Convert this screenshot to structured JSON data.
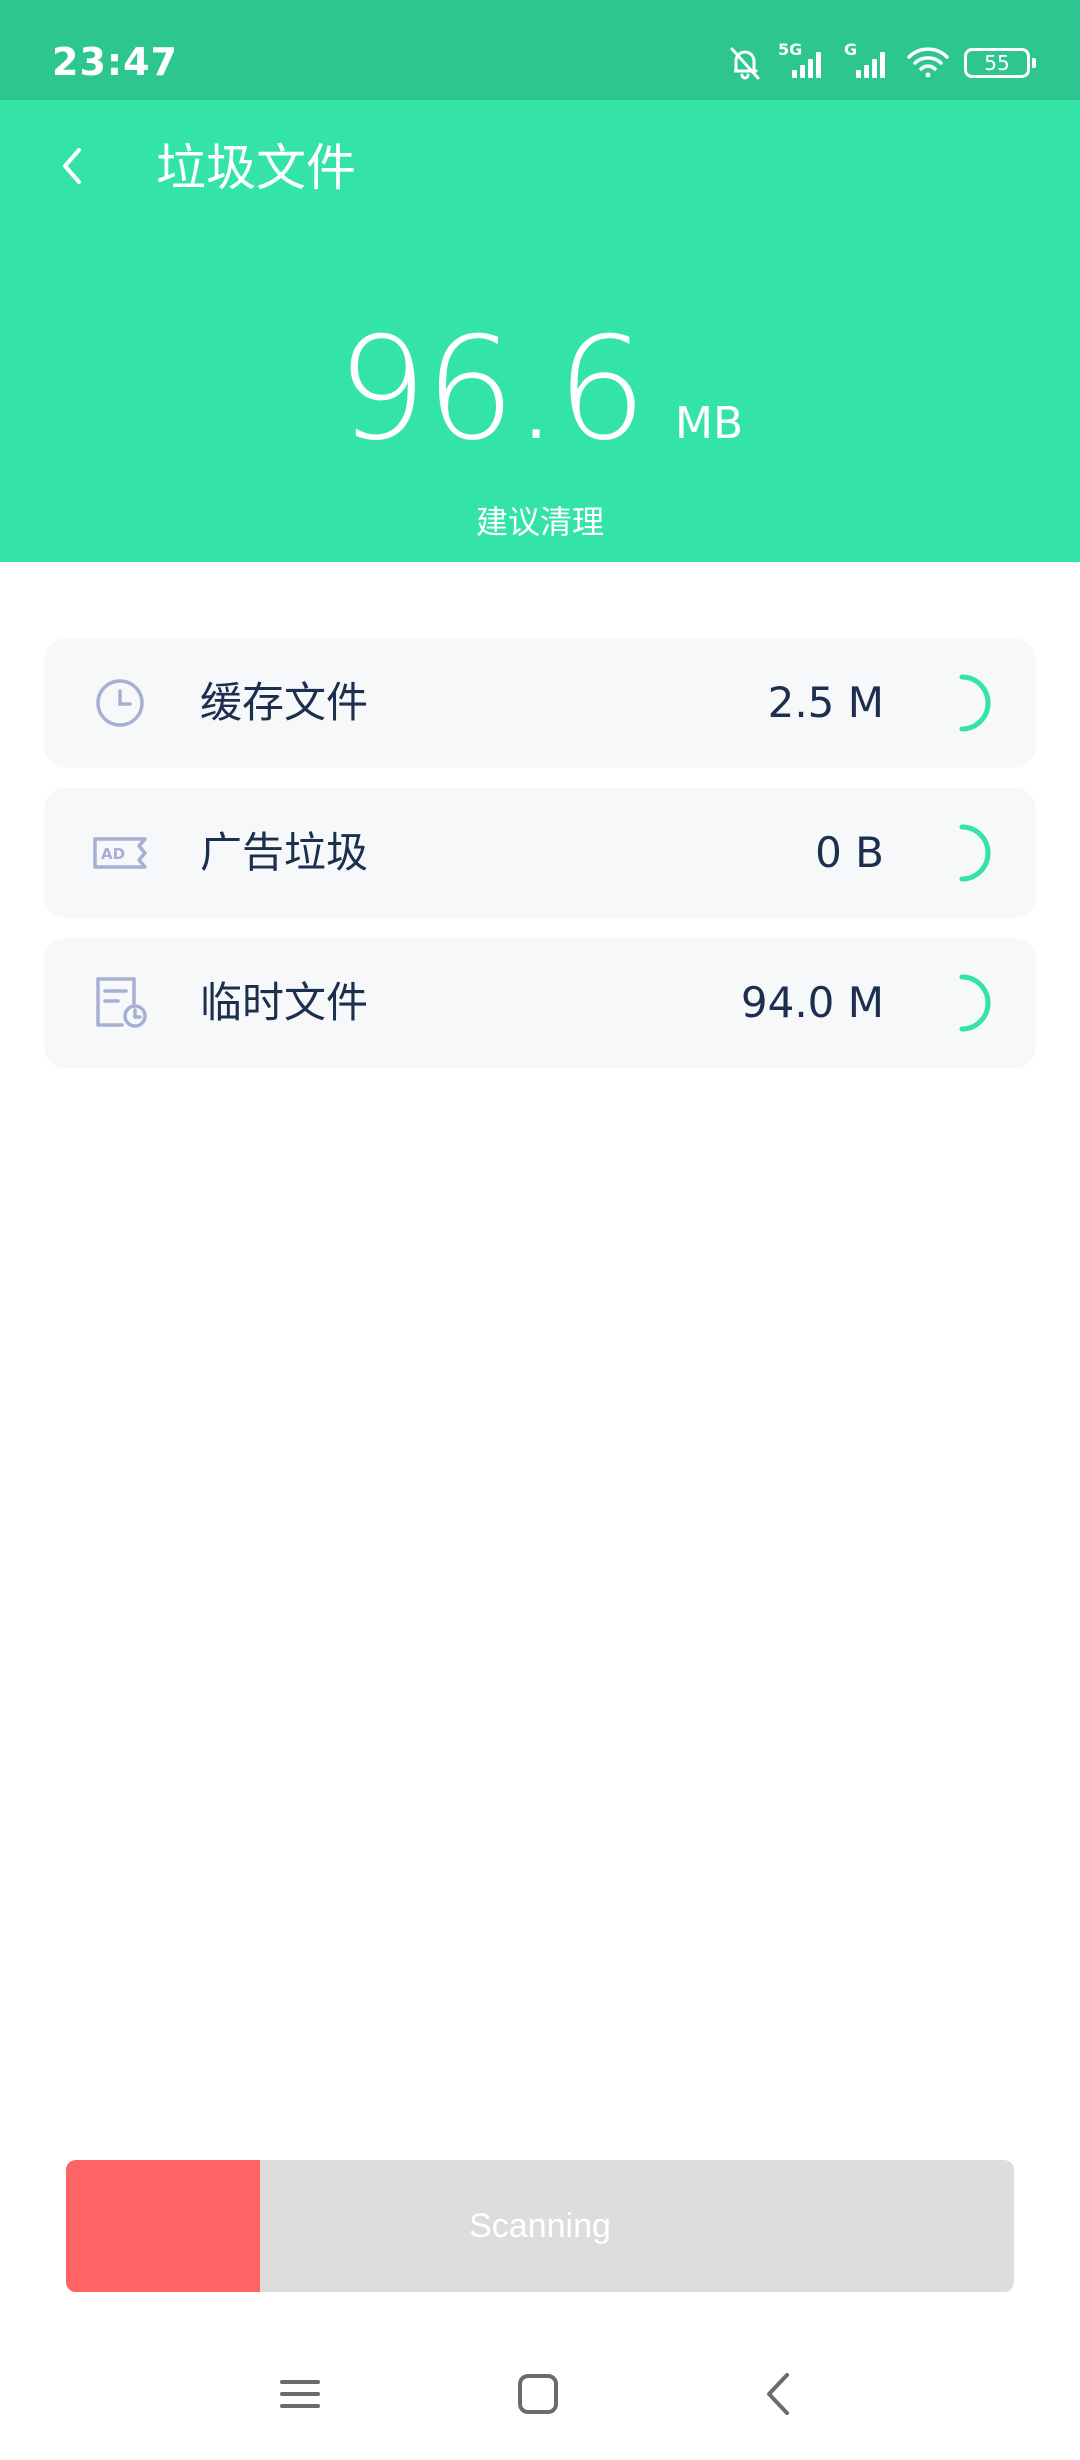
{
  "status_bar": {
    "time": "23:47",
    "network_1": "5G",
    "network_2": "G",
    "battery_level": "55",
    "icons": [
      "mute-bell-icon",
      "signal-5g-icon",
      "signal-g-icon",
      "wifi-icon",
      "battery-icon"
    ]
  },
  "header": {
    "title": "垃圾文件",
    "back_icon": "back-arrow-icon",
    "total_size_value": "96.6",
    "total_size_unit": "MB",
    "hint": "建议清理"
  },
  "categories": [
    {
      "label": "缓存文件",
      "size": "2.5 M",
      "icon": "clock-icon"
    },
    {
      "label": "广告垃圾",
      "size": "0 B",
      "icon": "ad-icon"
    },
    {
      "label": "临时文件",
      "size": "94.0 M",
      "icon": "temp-file-icon"
    }
  ],
  "scan_button": {
    "label": "Scanning",
    "progress_percent": 20.5
  },
  "nav_bar": {
    "icons": [
      "menu-icon",
      "home-icon",
      "back-icon"
    ]
  },
  "colors": {
    "status_bar": "#2cc68e",
    "header": "#34e3a6",
    "item_background": "#f6f8fa",
    "text_primary": "#1d2f4e",
    "icon_tint": "#a6b0d3",
    "spinner": "#34e3a6",
    "scan_fill": "#ff6464",
    "scan_track": "#dddddd"
  }
}
